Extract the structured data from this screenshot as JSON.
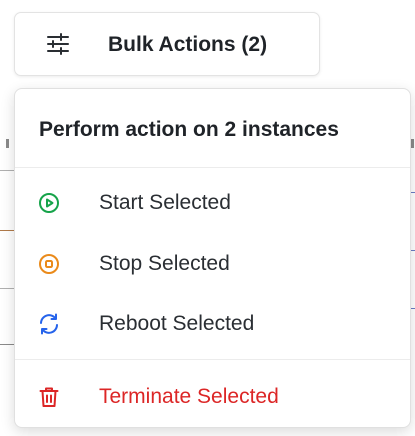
{
  "bulk_actions": {
    "label": "Bulk Actions (2)",
    "icon": "sliders-icon"
  },
  "menu": {
    "header": "Perform action on 2 instances",
    "items": [
      {
        "label": "Start Selected",
        "icon": "play-circle-icon",
        "color": "#16a34a"
      },
      {
        "label": "Stop Selected",
        "icon": "stop-circle-icon",
        "color": "#ea8a1a"
      },
      {
        "label": "Reboot Selected",
        "icon": "refresh-icon",
        "color": "#2563eb"
      },
      {
        "label": "Terminate Selected",
        "icon": "trash-icon",
        "color": "#dc2626"
      }
    ]
  },
  "colors": {
    "text": "#1f2328",
    "danger": "#dc2626",
    "border": "#e0e0e0"
  }
}
